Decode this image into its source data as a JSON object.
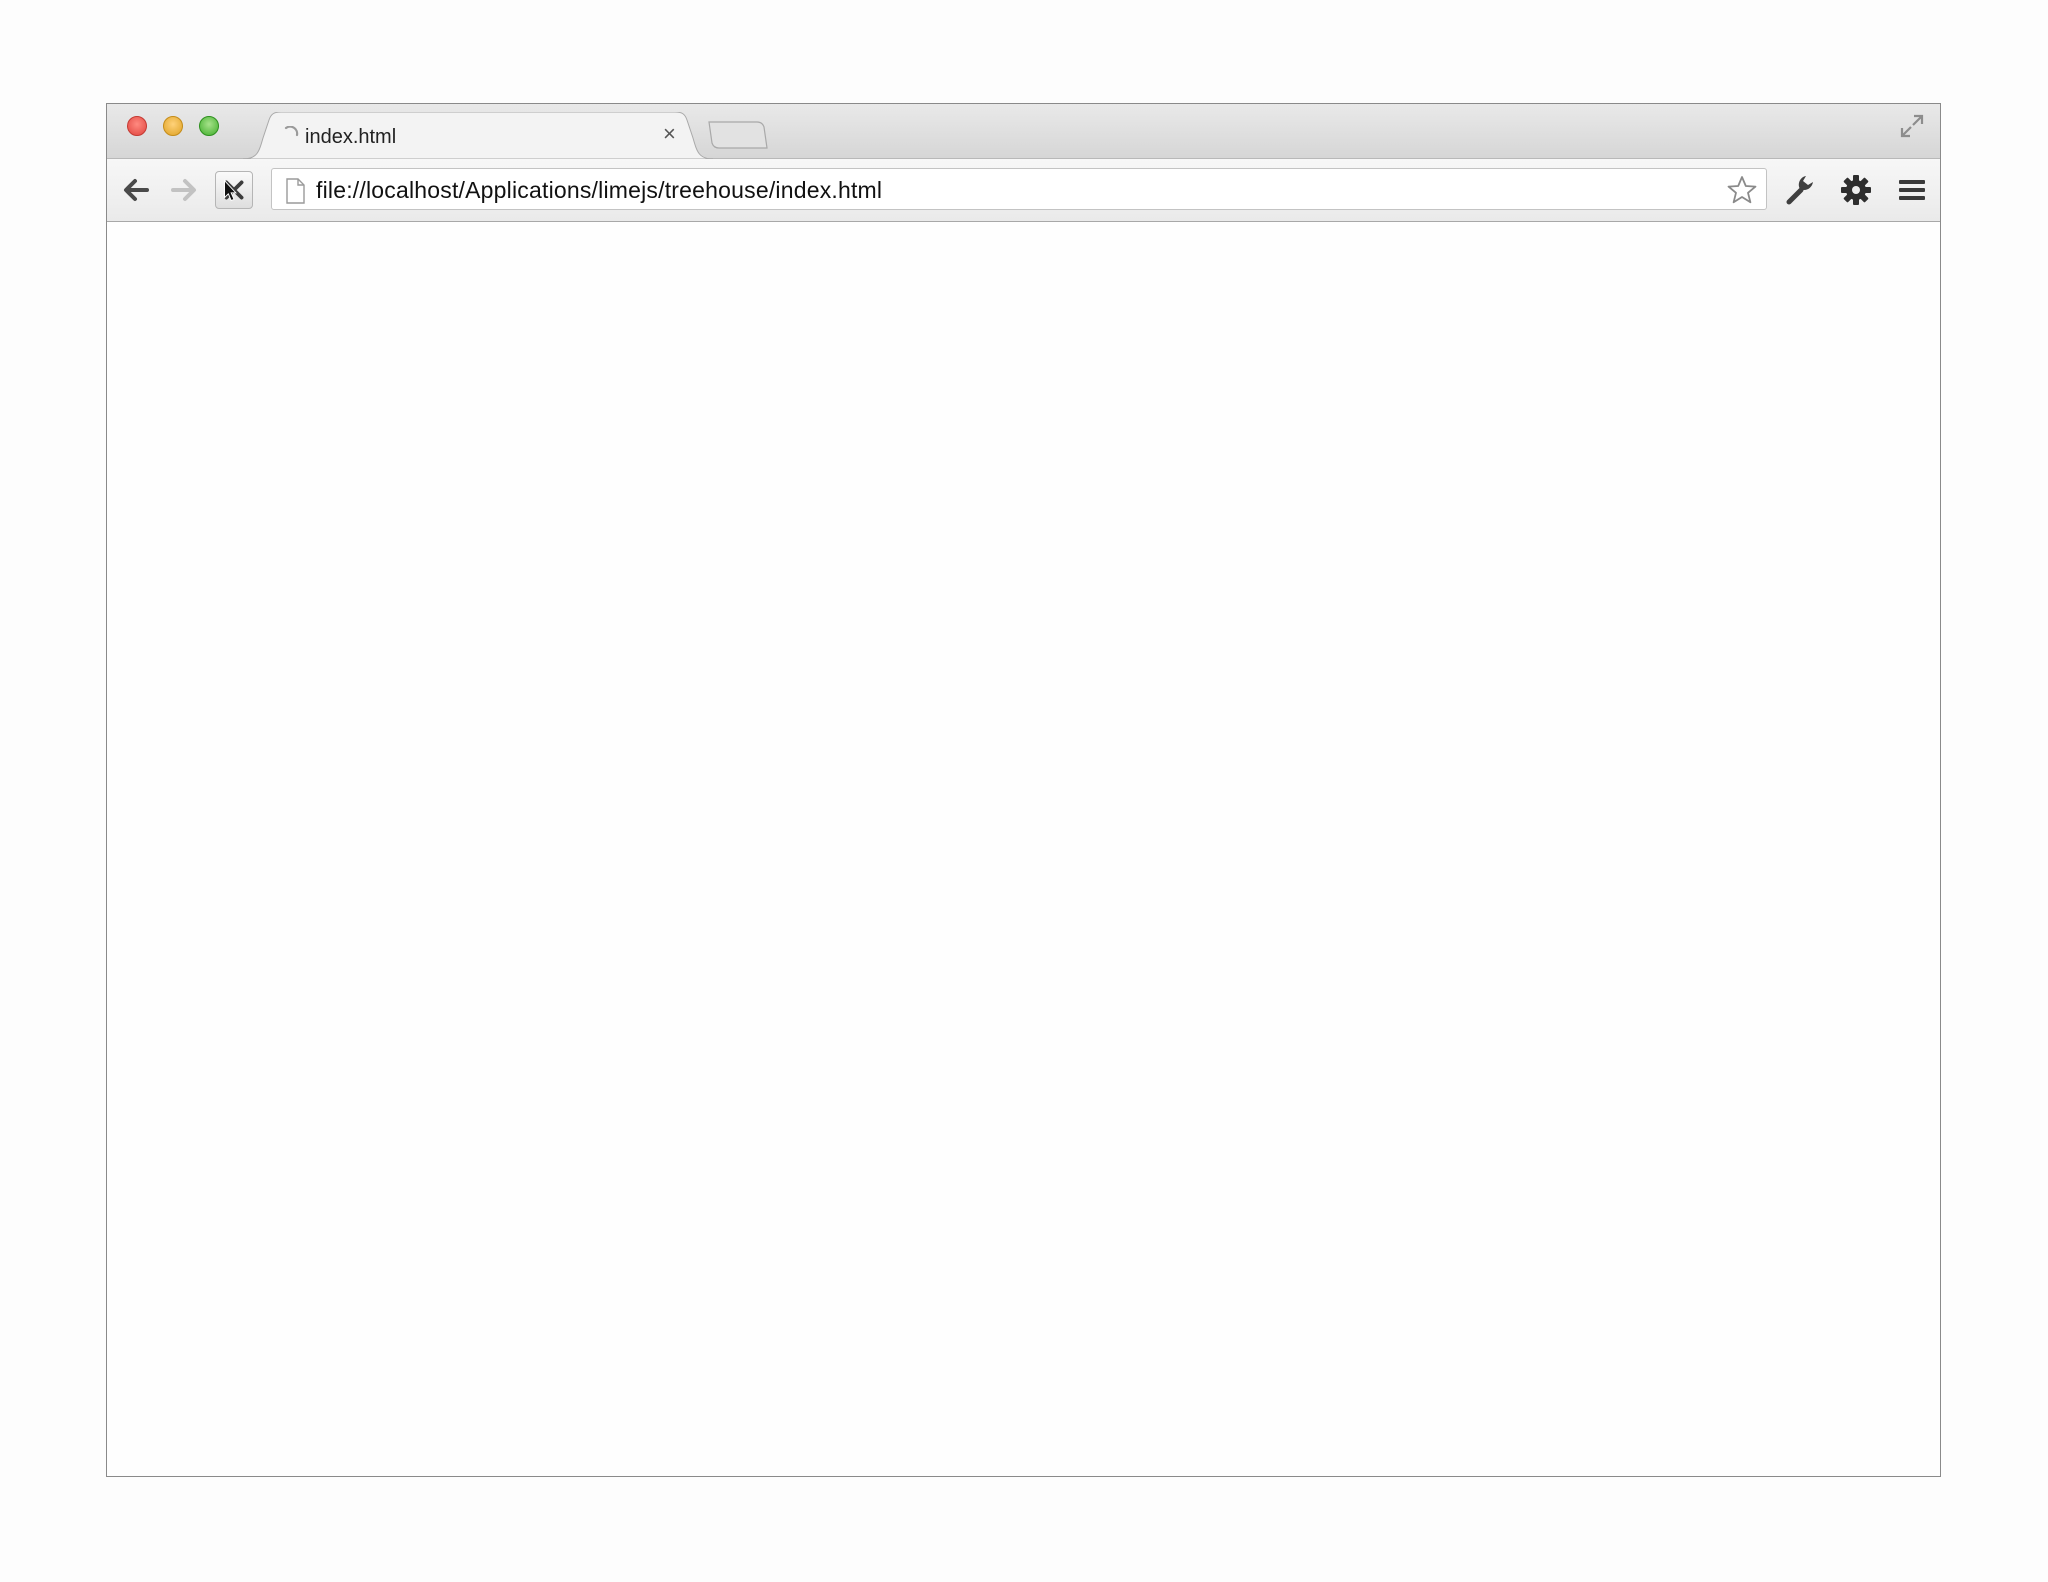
{
  "window": {
    "tab": {
      "title": "index.html",
      "close_glyph": "×"
    }
  },
  "toolbar": {
    "url": "file://localhost/Applications/limejs/treehouse/index.html"
  },
  "icons": {
    "back": "back-arrow-icon",
    "forward": "forward-arrow-icon",
    "stop": "stop-icon",
    "page": "page-icon",
    "star": "star-icon",
    "wrench": "wrench-icon",
    "gear": "gear-icon",
    "menu": "hamburger-menu-icon",
    "fullscreen": "fullscreen-icon",
    "spinner": "loading-spinner-icon"
  },
  "colors": {
    "close": "#e0443e",
    "minimize": "#dea123",
    "zoom": "#3fae2a"
  }
}
